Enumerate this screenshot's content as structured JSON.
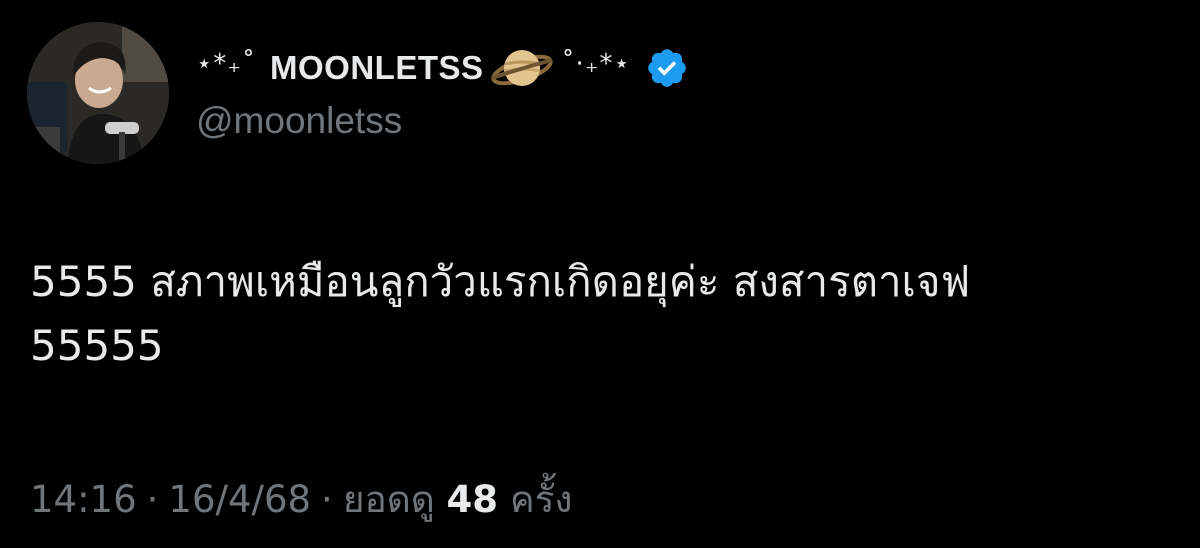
{
  "author": {
    "sparkle_left": "⋆*₊˚",
    "display_name": "MOONLETSS",
    "emoji": "saturn-planet-icon",
    "sparkle_right": "˚⋅₊*⋆",
    "verified": true,
    "handle": "@moonletss"
  },
  "tweet": {
    "lines": [
      "5555 สภาพเหมือนลูกวัวแรกเกิดอยุค่ะ สงสารตาเจฟ",
      "55555"
    ]
  },
  "meta": {
    "time": "14:16",
    "separator": "·",
    "date": "16/4/68",
    "views_label": "ยอดดู",
    "views_count": "48",
    "views_unit": "ครั้ง"
  },
  "colors": {
    "background": "#000000",
    "text": "#e7e9ea",
    "secondary": "#71767b",
    "verified": "#1d9bf0"
  }
}
